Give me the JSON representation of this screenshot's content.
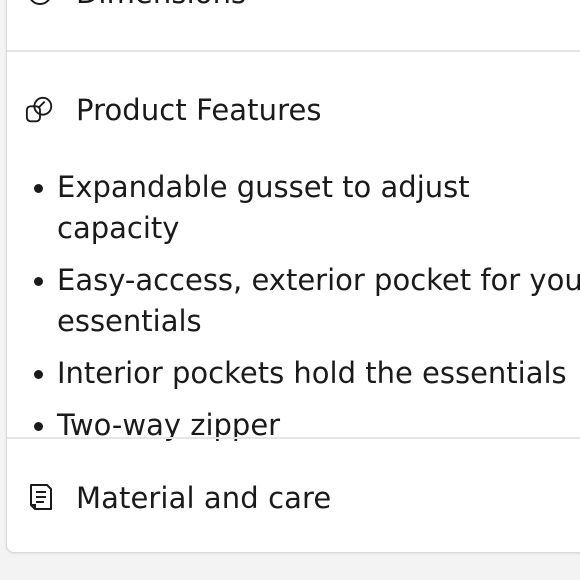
{
  "sections": {
    "dimensions": {
      "label": "Dimensions",
      "icon": "ruler-tape-icon"
    },
    "product_features": {
      "label": "Product Features",
      "icon": "overlapping-shapes-icon",
      "items": [
        "Expandable gusset to adjust capacity",
        "Easy-access, exterior pocket for your essentials",
        "Interior pockets hold the essentials",
        "Two-way zipper"
      ]
    },
    "material_and_care": {
      "label": "Material and care",
      "icon": "scroll-icon"
    }
  },
  "colors": {
    "text": "#1a1a1a",
    "divider": "#e4e4e4",
    "card_background": "#ffffff",
    "page_background": "#f3f3f3"
  }
}
